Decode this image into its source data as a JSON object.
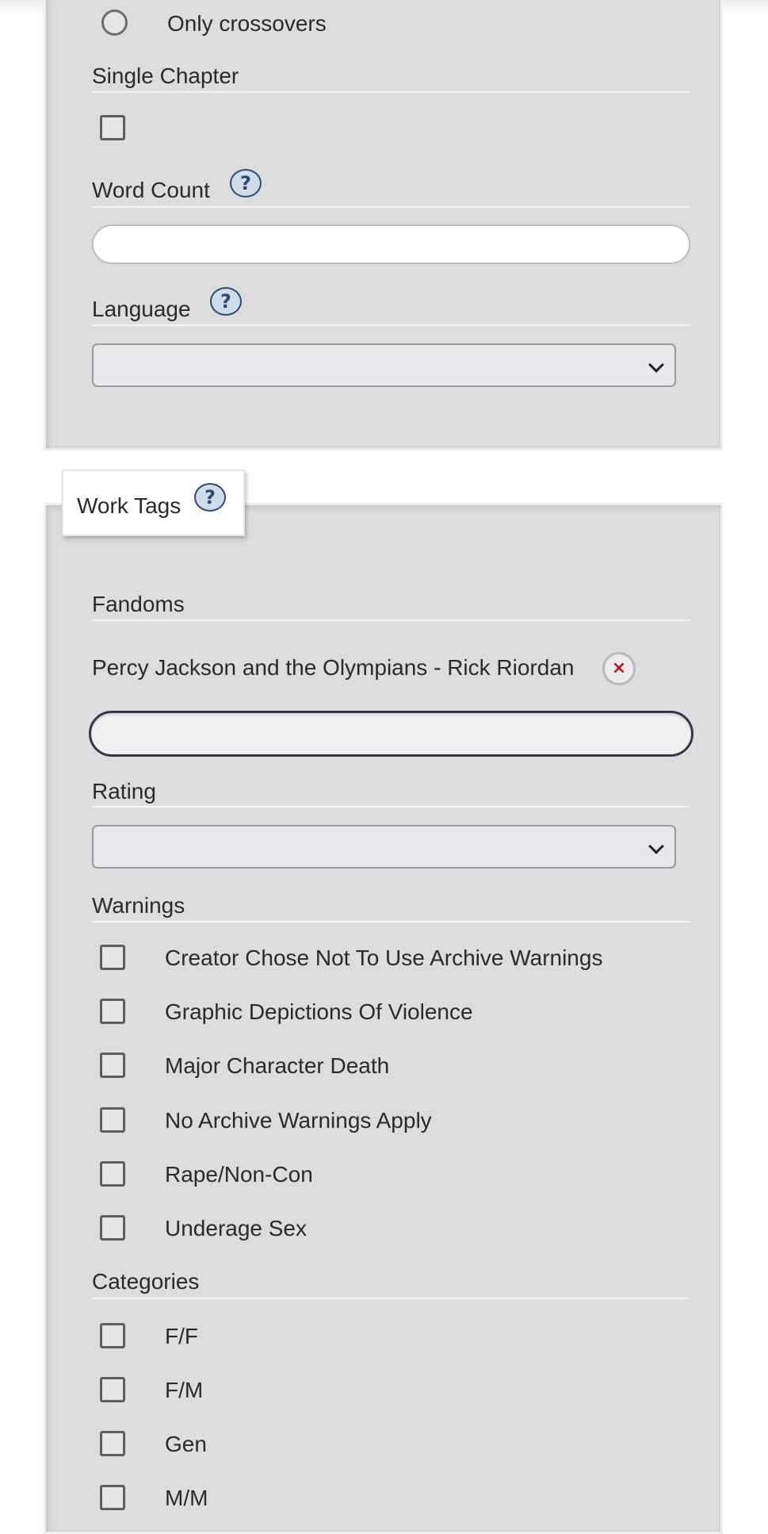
{
  "search_options": {
    "crossover_option": "Only crossovers",
    "single_chapter_label": "Single Chapter",
    "word_count_label": "Word Count",
    "word_count_value": "",
    "language_label": "Language",
    "language_selected": "",
    "help_glyph": "?"
  },
  "work_tags": {
    "legend": "Work Tags",
    "help_glyph": "?",
    "fandoms_label": "Fandoms",
    "selected_fandom": "Percy Jackson and the Olympians - Rick Riordan",
    "remove_glyph": "×",
    "fandom_input_value": "",
    "rating_label": "Rating",
    "rating_selected": "",
    "warnings_label": "Warnings",
    "warnings": [
      "Creator Chose Not To Use Archive Warnings",
      "Graphic Depictions Of Violence",
      "Major Character Death",
      "No Archive Warnings Apply",
      "Rape/Non-Con",
      "Underage Sex"
    ],
    "categories_label": "Categories",
    "categories": [
      "F/F",
      "F/M",
      "Gen",
      "M/M"
    ]
  },
  "colors": {
    "panel_bg": "#dddddd",
    "help_border": "#2d4b70",
    "help_fill": "#cfdce9",
    "remove_x": "#b0171d"
  },
  "icons": [
    "help-icon",
    "remove-icon",
    "chevron-down-icon"
  ]
}
